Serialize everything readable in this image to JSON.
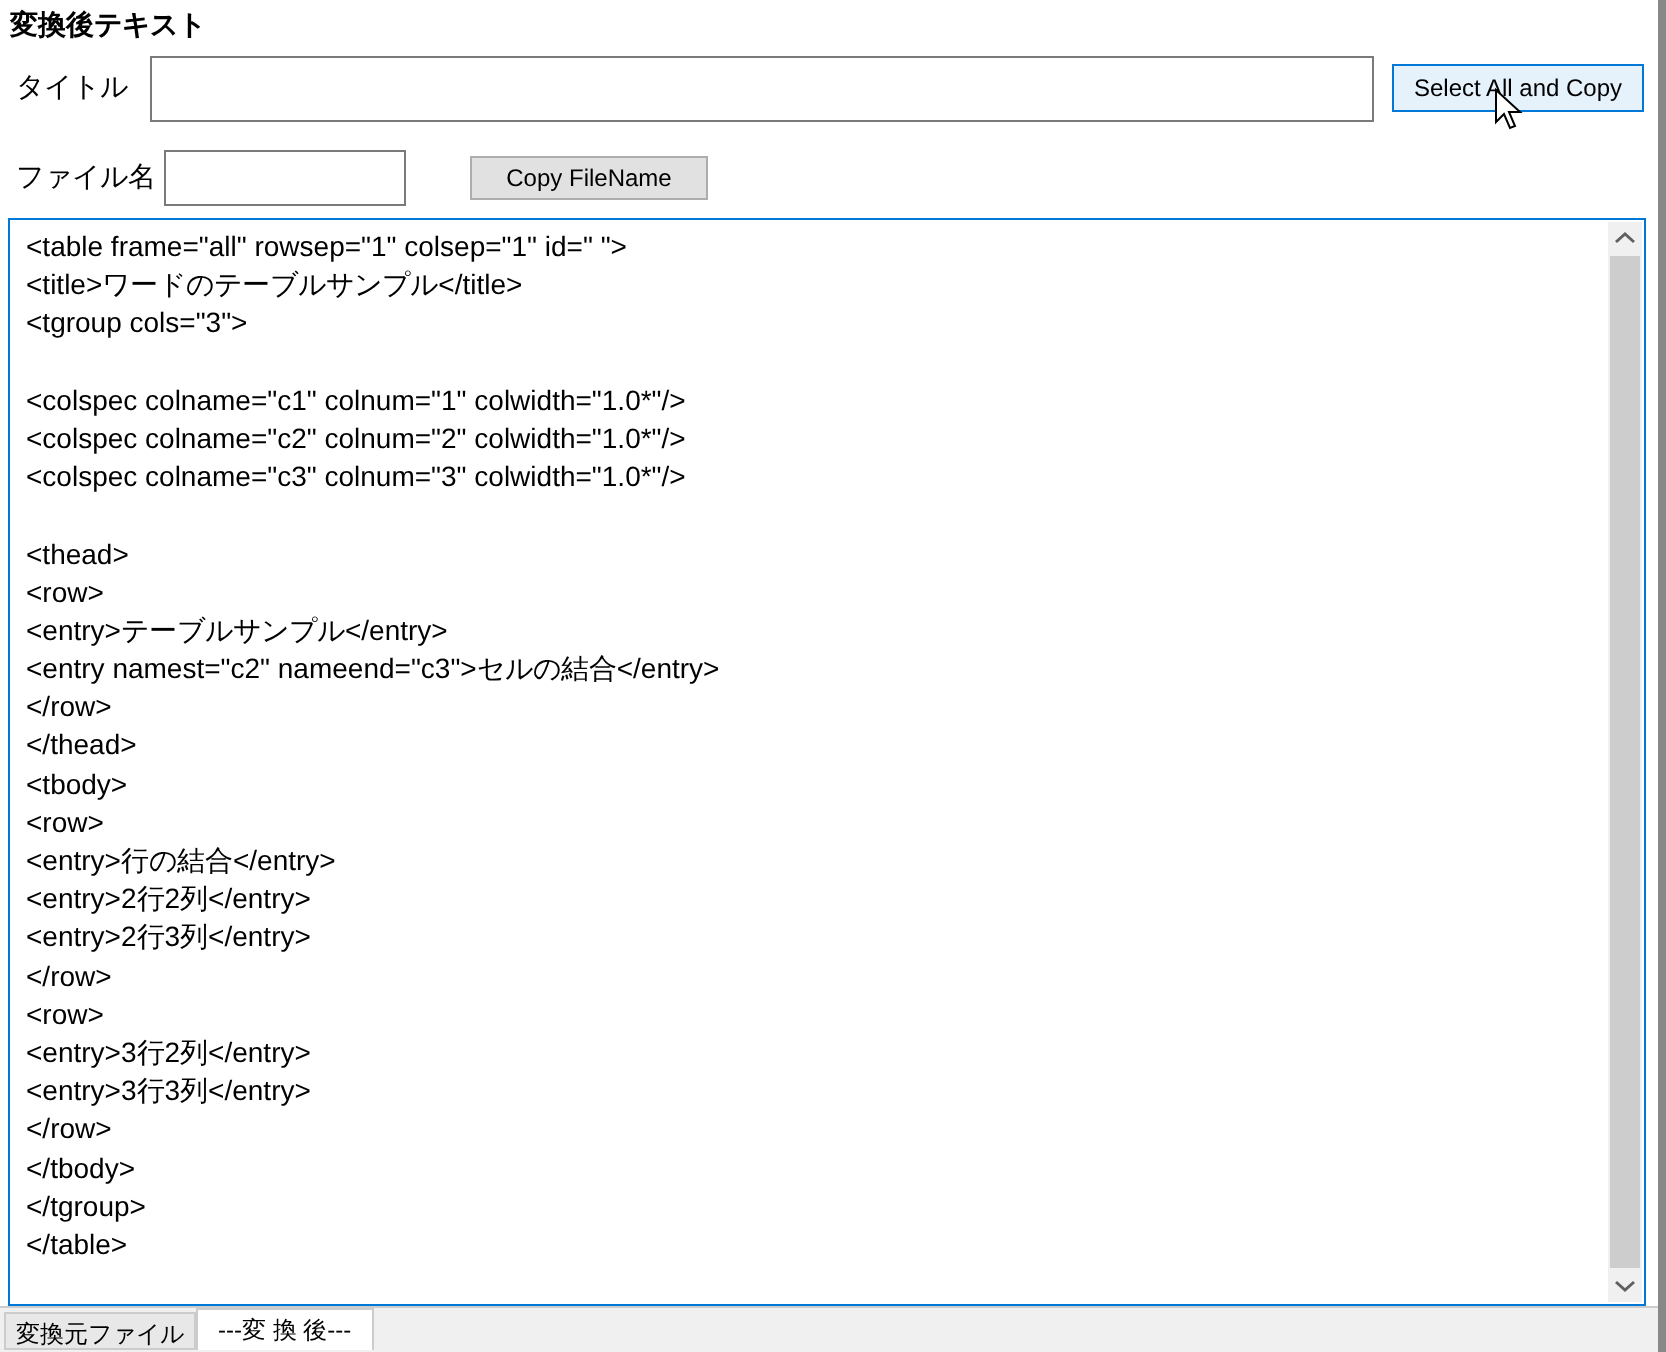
{
  "heading": "変換後テキスト",
  "title_field": {
    "label": "タイトル"
  },
  "select_button": {
    "label": "Select All and Copy",
    "hovered": true
  },
  "filename_field": {
    "label": "ファイル名"
  },
  "copy_filename_button": {
    "label": "Copy FileName"
  },
  "editor": {
    "blocks": [
      [
        "<table frame=\"all\" rowsep=\"1\" colsep=\"1\" id=\" \">",
        "<title>ワードのテーブルサンプル</title>",
        "<tgroup cols=\"3\">"
      ],
      [
        "<colspec colname=\"c1\" colnum=\"1\" colwidth=\"1.0*\"/>",
        "<colspec colname=\"c2\" colnum=\"2\" colwidth=\"1.0*\"/>",
        "<colspec colname=\"c3\" colnum=\"3\" colwidth=\"1.0*\"/>"
      ],
      [
        "<thead>",
        "<row>",
        "<entry>テーブルサンプル</entry>",
        "<entry namest=\"c2\" nameend=\"c3\">セルの結合</entry>",
        "</row>",
        "</thead>",
        "<tbody>",
        "<row>",
        "<entry>行の結合</entry>",
        "<entry>2行2列</entry>",
        "<entry>2行3列</entry>",
        "</row>",
        "<row>",
        "<entry>3行2列</entry>",
        "<entry>3行3列</entry>",
        "</row>",
        "</tbody>",
        "</tgroup>",
        "</table>"
      ]
    ]
  },
  "tabs": [
    {
      "label": "変換元ファイル",
      "selected": false
    },
    {
      "label": "---変 換 後---",
      "selected": true
    }
  ]
}
